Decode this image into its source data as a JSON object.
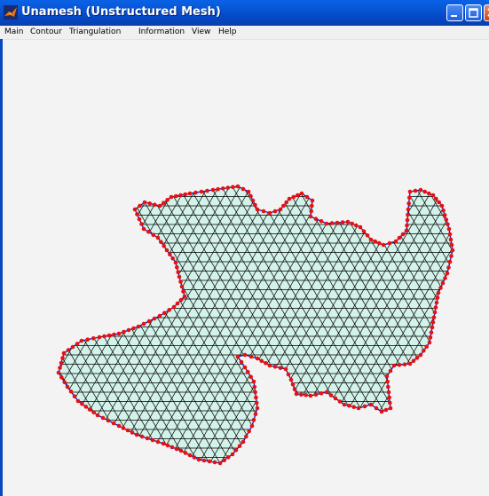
{
  "window": {
    "title": "Unamesh (Unstructured Mesh)",
    "app_icon": "matlab-logo-icon",
    "controls": [
      "minimize-icon",
      "maximize-icon",
      "close-icon"
    ]
  },
  "menu": {
    "main": "Main",
    "contour": "Contour",
    "triangulation": "Triangulation",
    "information": "Information",
    "view": "View",
    "help": "Help"
  },
  "colors": {
    "titlebar": "#0a5ad8",
    "mesh_fill": "#d3f2ea",
    "mesh_lines": "#000000",
    "boundary_edges": "#1010c8",
    "boundary_nodes": "#e81010",
    "canvas": "#f3f3f3"
  }
}
